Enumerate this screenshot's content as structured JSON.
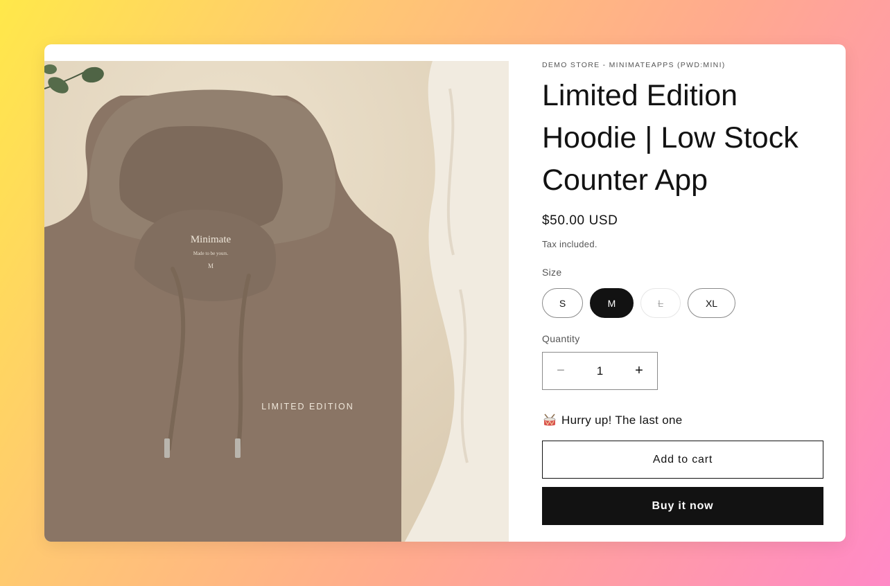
{
  "store": {
    "vendor": "Demo Store - MinimateApps (pwd:mini)"
  },
  "product": {
    "title": "Limited Edition Hoodie | Low Stock Counter App",
    "price": "$50.00 USD",
    "tax_note": "Tax included.",
    "image": {
      "label_brand": "Minimate",
      "label_tagline": "Made to be yours.",
      "label_size": "M",
      "chest_print": "LIMITED EDITION"
    }
  },
  "size_selector": {
    "label": "Size",
    "options": [
      {
        "label": "S",
        "state": "available"
      },
      {
        "label": "M",
        "state": "selected"
      },
      {
        "label": "L",
        "state": "sold-out"
      },
      {
        "label": "XL",
        "state": "available"
      }
    ]
  },
  "quantity": {
    "label": "Quantity",
    "value": "1",
    "minus": "−",
    "plus": "+"
  },
  "low_stock": {
    "icon": "drum-icon",
    "message": "Hurry up! The last one"
  },
  "buttons": {
    "add_to_cart": "Add to cart",
    "buy_now": "Buy it now"
  },
  "colors": {
    "dark": "#121212",
    "hoodie": "#8a7565",
    "background": "#e9ddc8"
  }
}
